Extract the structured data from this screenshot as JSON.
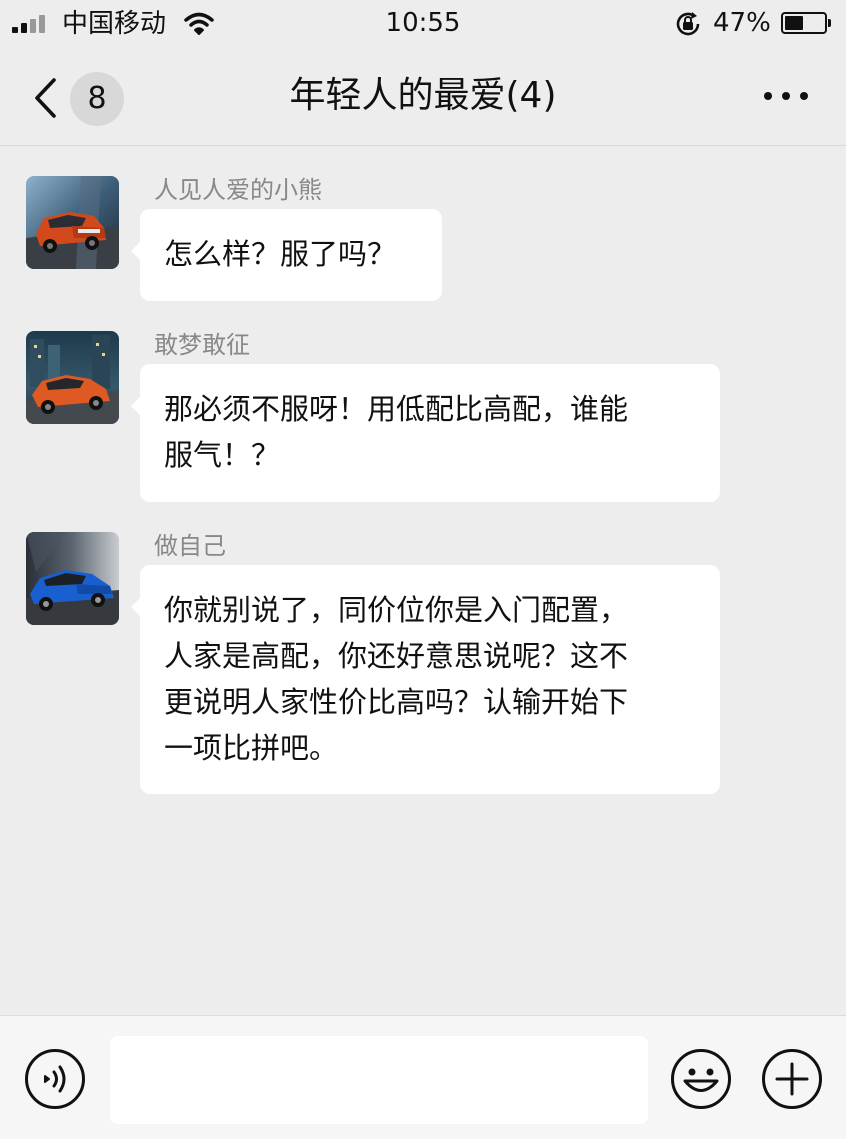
{
  "status_bar": {
    "carrier": "中国移动",
    "time": "10:55",
    "battery_percent": "47%",
    "battery_level": 0.47,
    "signal_icon": "cellular-signal-icon",
    "wifi_icon": "wifi-icon",
    "lock_icon": "orientation-lock-icon"
  },
  "nav": {
    "back_icon": "chevron-left-icon",
    "unread_count": "8",
    "title": "年轻人的最爱(4)",
    "more_icon": "ellipsis-icon"
  },
  "messages": [
    {
      "sender": "人见人爱的小熊",
      "avatar_icon": "orange-suv-avatar",
      "lines": [
        "怎么样？服了吗？"
      ]
    },
    {
      "sender": "敢梦敢征",
      "avatar_icon": "orange-suv-city-avatar",
      "lines": [
        "那必须不服呀！用低配比高配，谁能",
        "服气！？"
      ]
    },
    {
      "sender": "做自己",
      "avatar_icon": "blue-suv-avatar",
      "lines": [
        "你就别说了，同价位你是入门配置，",
        "人家是高配，你还好意思说呢？这不",
        "更说明人家性价比高吗？认输开始下",
        "一项比拼吧。"
      ]
    }
  ],
  "input_bar": {
    "voice_icon": "voice-input-icon",
    "text_value": "",
    "emoji_icon": "emoji-icon",
    "plus_icon": "plus-icon"
  },
  "colors": {
    "background": "#ededed",
    "bubble": "#ffffff",
    "sender_name": "#888888",
    "input_bar": "#f6f6f6"
  }
}
